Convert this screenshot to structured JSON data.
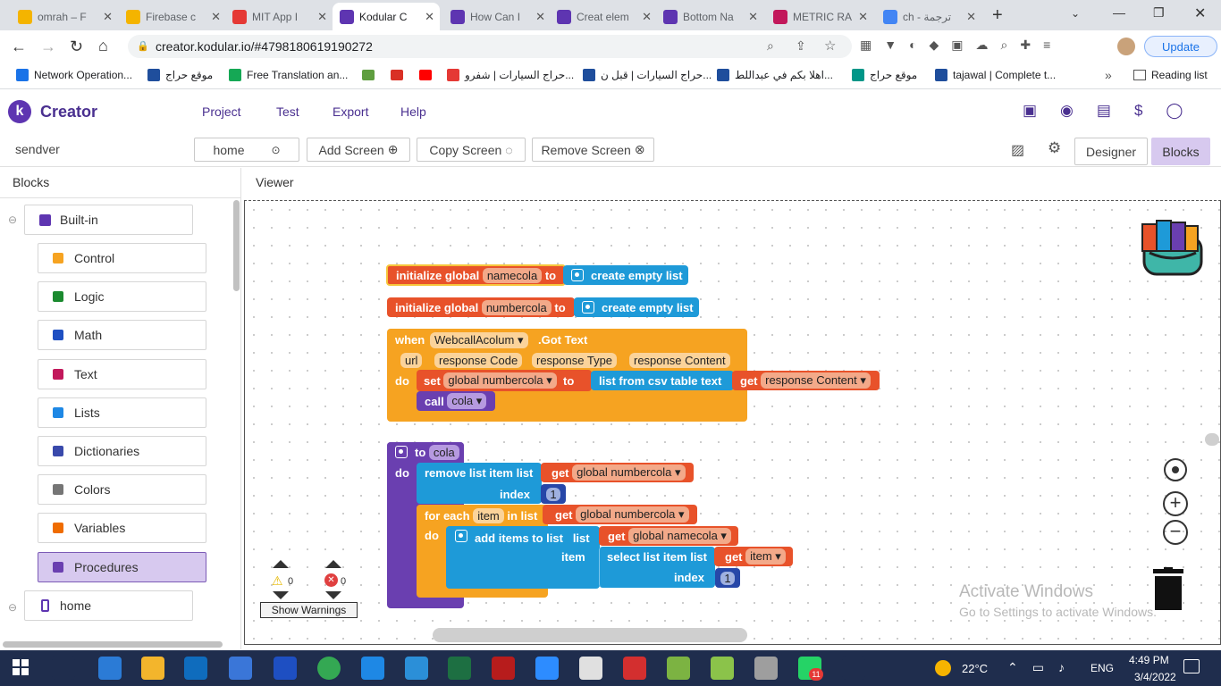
{
  "browser": {
    "tabs": [
      {
        "title": "omrah – F",
        "color": "#f4b400"
      },
      {
        "title": "Firebase c",
        "color": "#f4b400"
      },
      {
        "title": "MIT App I",
        "color": "#e53935"
      },
      {
        "title": "Kodular C",
        "color": "#5e35b1",
        "active": true
      },
      {
        "title": "How Can I",
        "color": "#5e35b1"
      },
      {
        "title": "Creat elem",
        "color": "#5e35b1"
      },
      {
        "title": "Bottom Na",
        "color": "#5e35b1"
      },
      {
        "title": "METRIC RA",
        "color": "#c2185b"
      },
      {
        "title": "ch - ترجمة",
        "color": "#4285f4"
      }
    ],
    "url": "creator.kodular.io/#4798180619190272",
    "update_label": "Update",
    "reading_list": "Reading list",
    "bookmarks": [
      "Network Operation...",
      "موقع حراج",
      "Free Translation an...",
      "حراج السيارات | شفرو...",
      "حراج السيارات | قبل ن...",
      "اهلا بكم في عبداللط...",
      "موقع حراج",
      "tajawal | Complete t..."
    ]
  },
  "app": {
    "brand": "Creator",
    "menu": [
      "Project",
      "Test",
      "Export",
      "Help"
    ],
    "project_name": "sendver",
    "screen_select": "home",
    "add_screen": "Add Screen",
    "copy_screen": "Copy Screen",
    "remove_screen": "Remove Screen",
    "designer_btn": "Designer",
    "blocks_btn": "Blocks",
    "accent": "#5e35b1"
  },
  "blocks_panel": {
    "title": "Blocks",
    "builtin_label": "Built-in",
    "items": [
      {
        "label": "Control",
        "color": "#f6a321"
      },
      {
        "label": "Logic",
        "color": "#1b8a2f"
      },
      {
        "label": "Math",
        "color": "#1e4fc2"
      },
      {
        "label": "Text",
        "color": "#c2185b"
      },
      {
        "label": "Lists",
        "color": "#1e88e5"
      },
      {
        "label": "Dictionaries",
        "color": "#3949ab"
      },
      {
        "label": "Colors",
        "color": "#757575"
      },
      {
        "label": "Variables",
        "color": "#ef6c00"
      },
      {
        "label": "Procedures",
        "color": "#6a3fb0"
      }
    ],
    "home_label": "home"
  },
  "viewer": {
    "title": "Viewer",
    "warnings_count": "0",
    "errors_count": "0",
    "show_warnings": "Show Warnings",
    "watermark_title": "Activate Windows",
    "watermark_sub": "Go to Settings to activate Windows."
  },
  "code": {
    "init1": {
      "kw": "initialize global",
      "name": "namecola",
      "to": "to",
      "value": "create empty list"
    },
    "init2": {
      "kw": "initialize global",
      "name": "numbercola",
      "to": "to",
      "value": "create empty list"
    },
    "event": {
      "when": "when",
      "component": "WebcallAcolum",
      "event": ".Got Text",
      "params": [
        "url",
        "response Code",
        "response Type",
        "response Content"
      ],
      "do": "do",
      "set": "set",
      "set_var": "global numbercola",
      "set_to": "to",
      "csv": "list from csv table  text",
      "get": "get",
      "get_var": "response Content",
      "call": "call",
      "call_proc": "cola"
    },
    "proc": {
      "to": "to",
      "name": "cola",
      "do": "do",
      "remove": "remove list item  list",
      "index": "index",
      "index_val": "1",
      "get": "get",
      "num_var": "global numbercola",
      "foreach": "for each",
      "item": "item",
      "inlist": "in list",
      "do2": "do",
      "add": "add items to list",
      "list": "list",
      "name_var": "global namecola",
      "item_lbl": "item",
      "select": "select list item  list",
      "get_item": "item",
      "index2": "index",
      "index2_val": "1"
    }
  },
  "taskbar": {
    "temp": "22°C",
    "lang": "ENG",
    "time": "4:49 PM",
    "date": "3/4/2022",
    "badge": "11"
  }
}
